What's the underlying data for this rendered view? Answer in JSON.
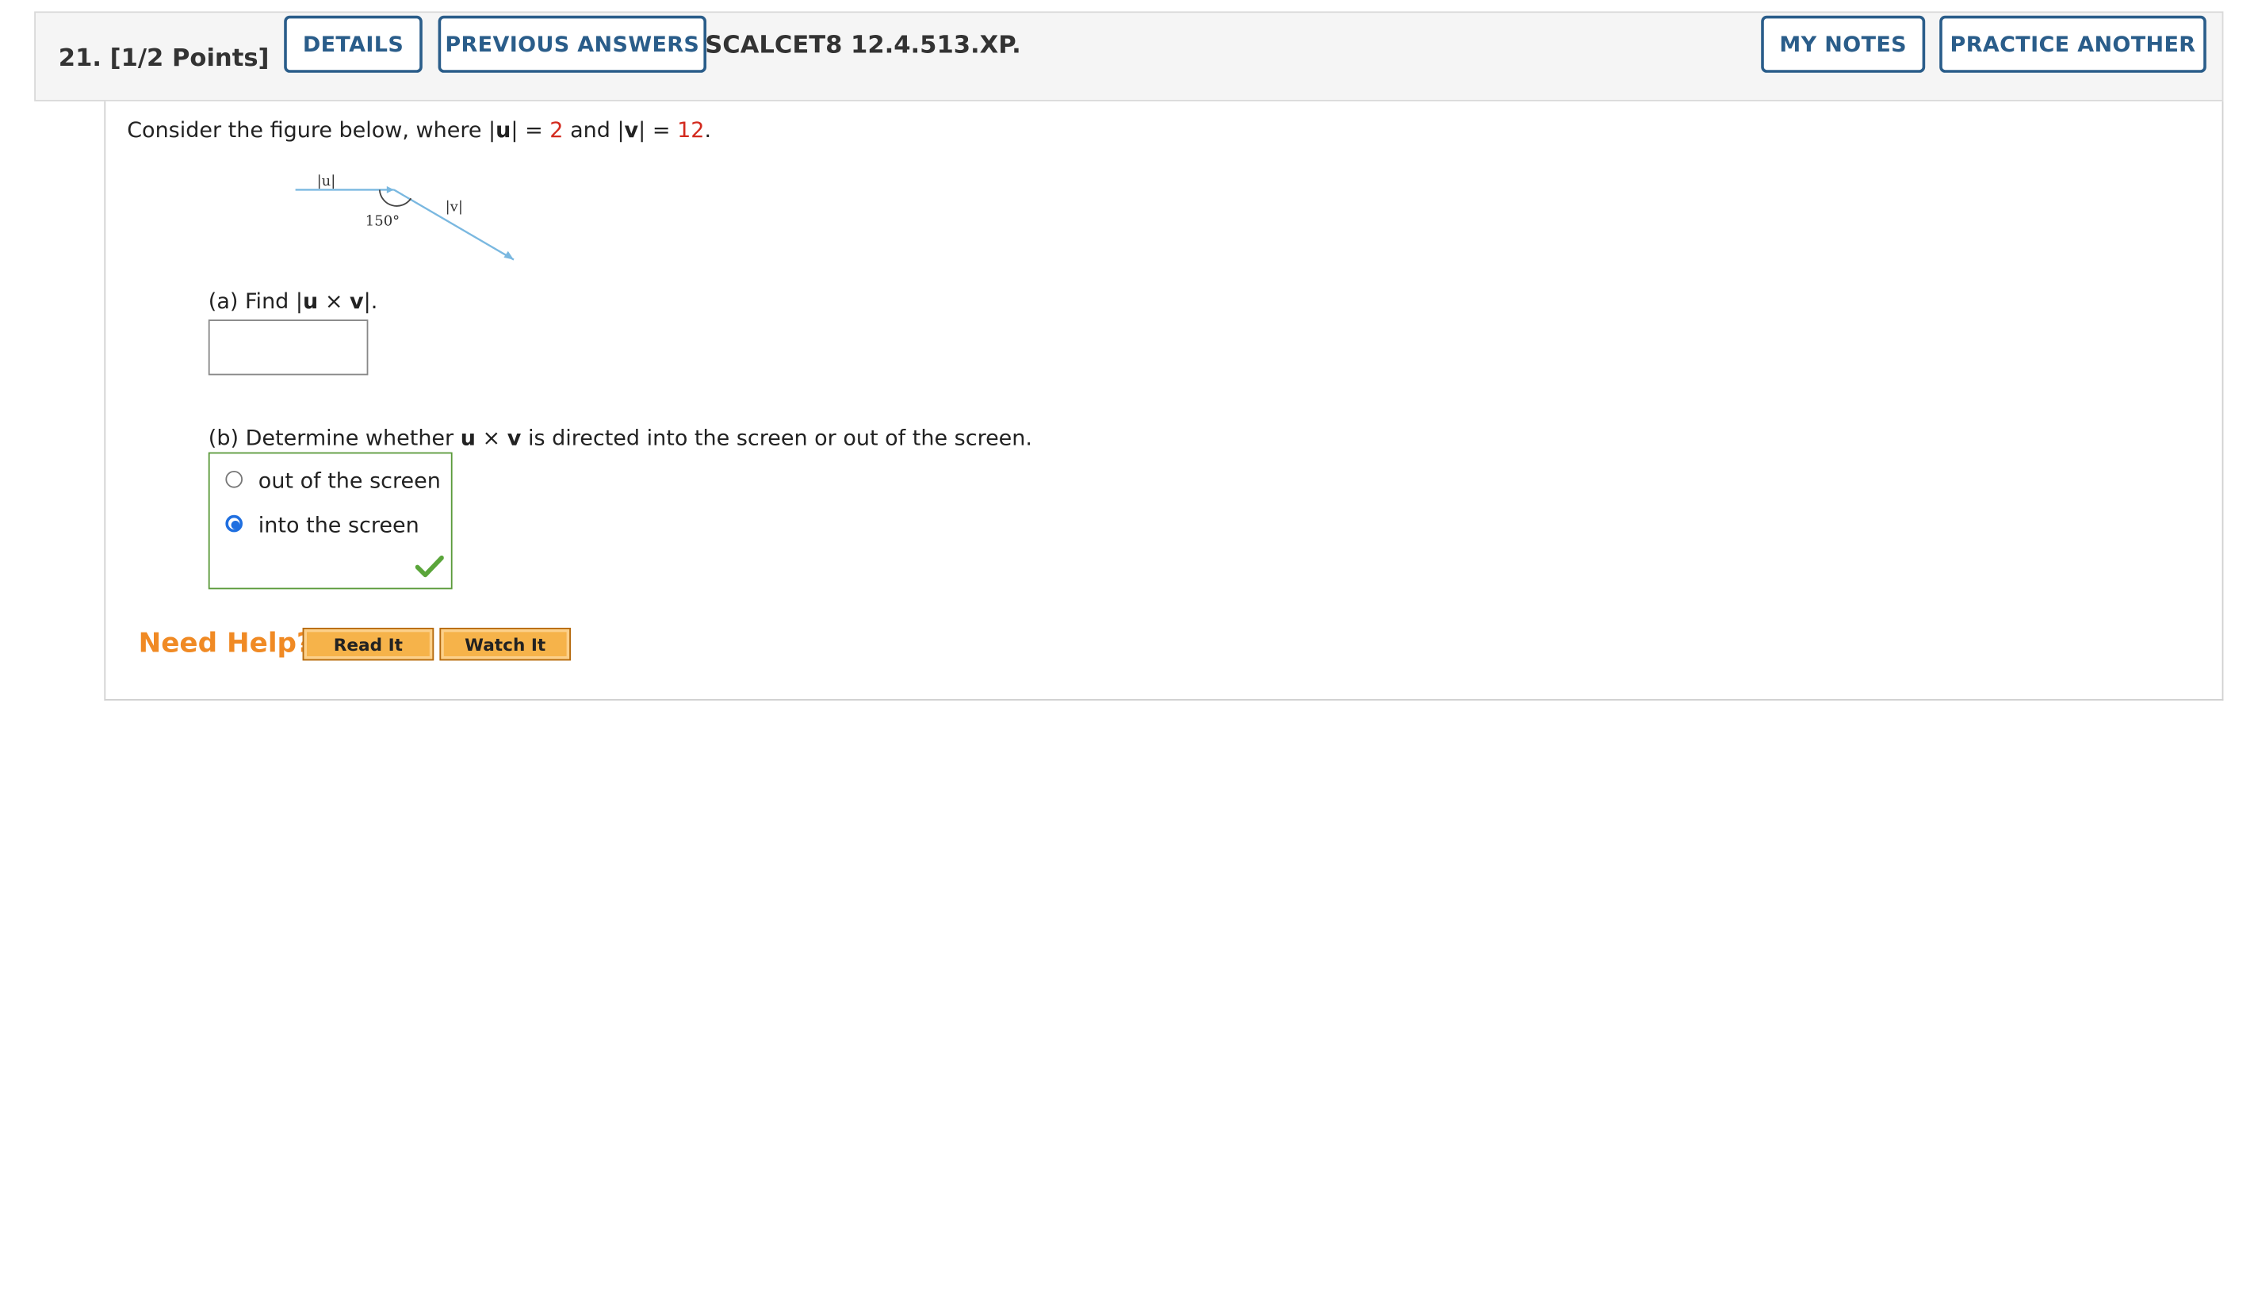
{
  "question": {
    "number": "21.",
    "points": "[1/2 Points]",
    "details_label": "DETAILS",
    "previous_answers_label": "PREVIOUS ANSWERS",
    "code": "SCALCET8 12.4.513.XP.",
    "my_notes_label": "MY NOTES",
    "practice_another_label": "PRACTICE ANOTHER"
  },
  "problem": {
    "intro_pre": "Consider the figure below, where |",
    "u": "u",
    "intro_mid1": "| = ",
    "u_val": "2",
    "intro_mid2": " and |",
    "v": "v",
    "intro_mid3": "| = ",
    "v_val": "12",
    "intro_end": ".",
    "figure": {
      "u_label": "|u|",
      "v_label": "|v|",
      "angle_label": "150°"
    }
  },
  "part_a": {
    "prefix": "(a) Find |",
    "u": "u",
    "times": " × ",
    "v": "v",
    "suffix": "|.",
    "answer_value": ""
  },
  "part_b": {
    "prefix": "(b) Determine whether ",
    "u": "u",
    "times": " × ",
    "v": "v",
    "suffix": " is directed into the screen or out of the screen.",
    "options": [
      "out of the screen",
      "into the screen"
    ],
    "selected": "into the screen"
  },
  "help": {
    "label": "Need Help?",
    "read_it": "Read It",
    "watch_it": "Watch It"
  },
  "colors": {
    "button_border": "#2a5d8a",
    "given_value": "#d32a1e",
    "correct": "#5a9a3a",
    "vector": "#7ab8e0",
    "help": "#f08a24"
  }
}
